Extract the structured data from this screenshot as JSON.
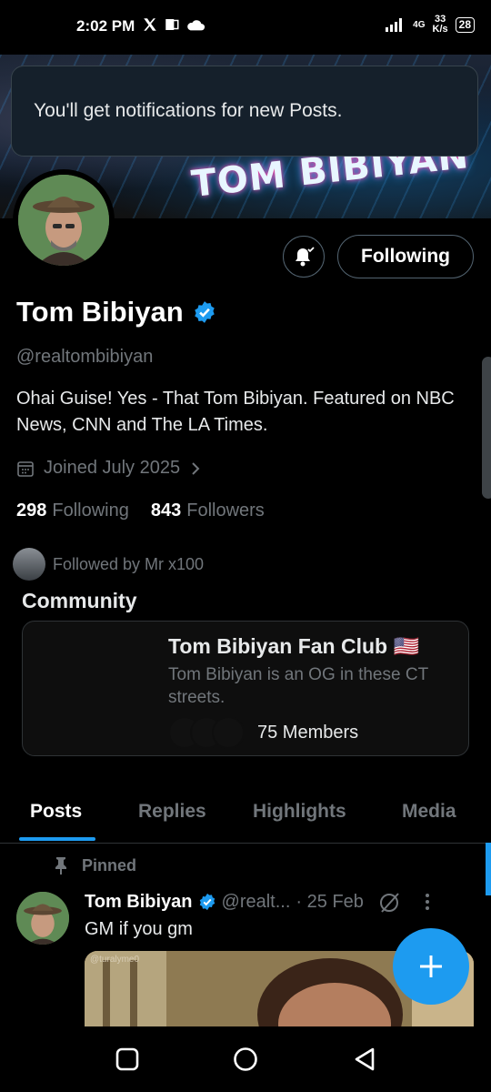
{
  "status_bar": {
    "time": "2:02 PM",
    "network": "4G",
    "speed_value": "33",
    "speed_unit": "K/s",
    "battery": "28"
  },
  "banner": {
    "neon_text": "TOM BIBIYAN"
  },
  "toast": {
    "message": "You'll get notifications for new Posts."
  },
  "profile": {
    "name": "Tom Bibiyan",
    "handle": "@realtombibiyan",
    "bio": "Ohai Guise! Yes - That Tom Bibiyan. Featured on NBC News, CNN and The LA Times.",
    "joined": "Joined July 2025",
    "following_count": "298",
    "following_label": "Following",
    "followers_count": "843",
    "followers_label": "Followers",
    "followed_by": "Followed by Mr x100",
    "follow_button": "Following"
  },
  "community": {
    "section_title": "Community",
    "name": "Tom Bibiyan Fan Club 🇺🇸",
    "description": "Tom Bibiyan is an OG in these CT streets.",
    "members": "75 Members"
  },
  "tabs": [
    "Posts",
    "Replies",
    "Highlights",
    "Media"
  ],
  "post": {
    "pinned_label": "Pinned",
    "author": "Tom Bibiyan",
    "handle": "@realt...",
    "date": "· 25 Feb",
    "text": "GM if you gm",
    "media_caption": "@turalyme0"
  },
  "colors": {
    "accent": "#1d9bf0",
    "background": "#000000",
    "muted": "#71767b"
  }
}
